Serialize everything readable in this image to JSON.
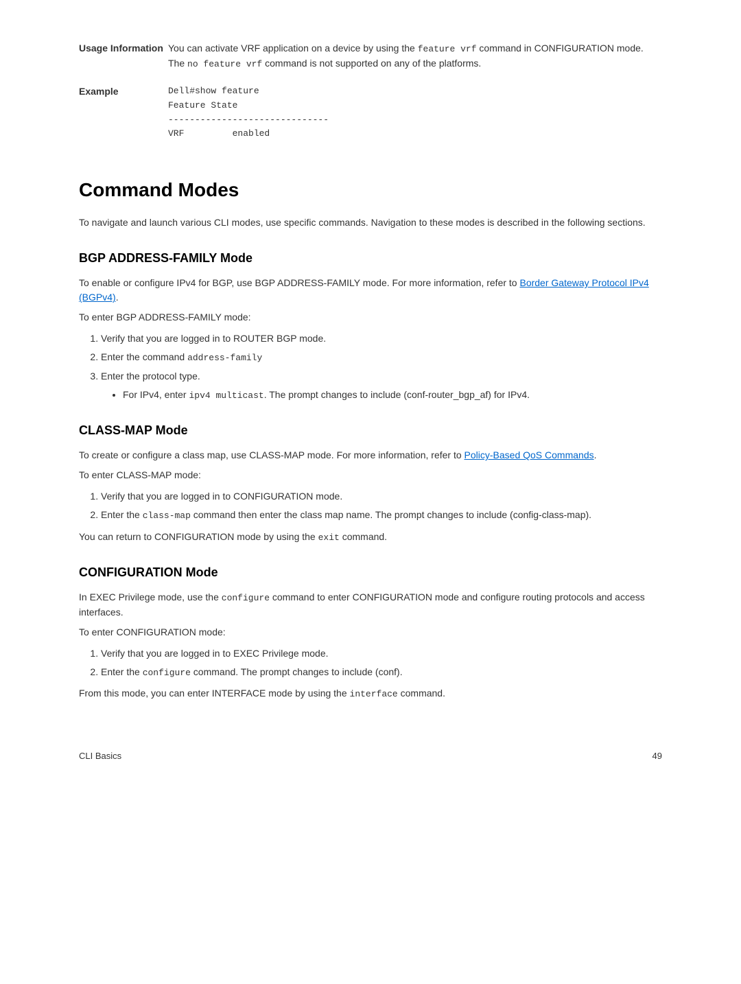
{
  "usage": {
    "label": "Usage Information",
    "text_part1": "You can activate VRF application on a device by using the ",
    "code1": "feature vrf",
    "text_part2": " command in CONFIGURATION mode. The ",
    "code2": "no feature vrf",
    "text_part3": " command is not supported on any of the platforms."
  },
  "example": {
    "label": "Example",
    "content": "Dell#show feature\nFeature State\n------------------------------\nVRF         enabled"
  },
  "heading1": "Command Modes",
  "intro_p": "To navigate and launch various CLI modes, use specific commands. Navigation to these modes is described in the following sections.",
  "bgp": {
    "heading": "BGP ADDRESS-FAMILY Mode",
    "p1_part1": "To enable or configure IPv4 for BGP, use BGP ADDRESS-FAMILY mode. For more information, refer to ",
    "p1_link": "Border Gateway Protocol IPv4 (BGPv4)",
    "p1_part2": ".",
    "p2": "To enter BGP ADDRESS-FAMILY mode:",
    "li1": "Verify that you are logged in to ROUTER BGP mode.",
    "li2_part1": "Enter the command ",
    "li2_code": "address-family",
    "li3": "Enter the protocol type.",
    "li3_sub_part1": "For IPv4, enter ",
    "li3_sub_code": "ipv4 multicast",
    "li3_sub_part2": ". The prompt changes to include (conf-router_bgp_af) for IPv4."
  },
  "classmap": {
    "heading": "CLASS-MAP Mode",
    "p1_part1": "To create or configure a class map, use CLASS-MAP mode. For more information, refer to ",
    "p1_link": "Policy-Based QoS Commands",
    "p1_part2": ".",
    "p2": "To enter CLASS-MAP mode:",
    "li1": "Verify that you are logged in to CONFIGURATION mode.",
    "li2_part1": "Enter the ",
    "li2_code": "class-map",
    "li2_part2": " command then enter the class map name. The prompt changes to include (config-class-map).",
    "p3_part1": "You can return to CONFIGURATION mode by using the ",
    "p3_code": "exit",
    "p3_part2": " command."
  },
  "config": {
    "heading": "CONFIGURATION Mode",
    "p1_part1": "In EXEC Privilege mode, use the ",
    "p1_code": "configure",
    "p1_part2": " command to enter CONFIGURATION mode and configure routing protocols and access interfaces.",
    "p2": "To enter CONFIGURATION mode:",
    "li1": "Verify that you are logged in to EXEC Privilege mode.",
    "li2_part1": "Enter the ",
    "li2_code": "configure",
    "li2_part2": " command. The prompt changes to include (conf).",
    "p3_part1": "From this mode, you can enter INTERFACE mode by using the ",
    "p3_code": "interface",
    "p3_part2": " command."
  },
  "footer": {
    "left": "CLI Basics",
    "right": "49"
  }
}
